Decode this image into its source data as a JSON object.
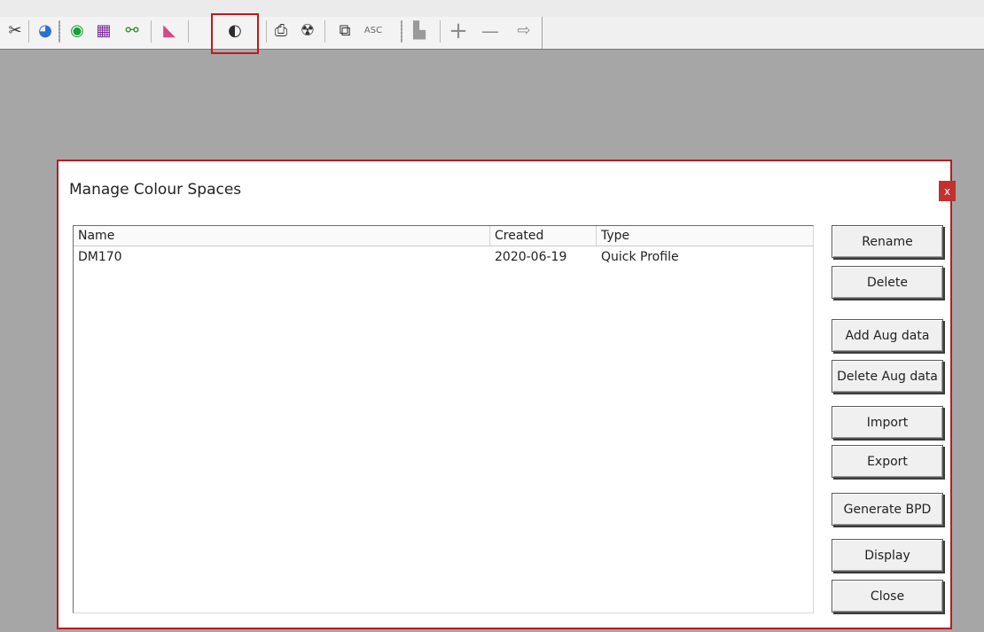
{
  "toolbar": {
    "icons": [
      {
        "name": "tools-icon",
        "glyph": "✂"
      },
      {
        "name": "globe-icon",
        "glyph": "◕"
      },
      {
        "name": "color-wheel-icon",
        "glyph": "◉"
      },
      {
        "name": "color-chart-icon",
        "glyph": "▦"
      },
      {
        "name": "network-icon",
        "glyph": "⚯"
      },
      {
        "name": "gamut-icon",
        "glyph": "◣"
      },
      {
        "name": "colour-spaces-icon",
        "glyph": "◐"
      },
      {
        "name": "print-icon",
        "glyph": "⎙"
      },
      {
        "name": "radiation-icon",
        "glyph": "☢"
      },
      {
        "name": "copy-icon",
        "glyph": "⧉"
      },
      {
        "name": "asc-icon",
        "glyph": "ASC"
      },
      {
        "name": "save-icon",
        "glyph": "▙"
      },
      {
        "name": "plus-icon",
        "glyph": "+"
      },
      {
        "name": "minus-icon",
        "glyph": "—"
      },
      {
        "name": "export-icon",
        "glyph": "⇨"
      }
    ]
  },
  "dialog": {
    "title": "Manage Colour Spaces",
    "close_glyph": "x",
    "columns": [
      "Name",
      "Created",
      "Type"
    ],
    "rows": [
      {
        "name": "DM170",
        "created": "2020-06-19",
        "type": "Quick Profile"
      }
    ],
    "buttons": {
      "rename": "Rename",
      "delete": "Delete",
      "add_aug": "Add Aug data",
      "delete_aug": "Delete Aug data",
      "import": "Import",
      "export": "Export",
      "generate_bpd": "Generate BPD",
      "display": "Display",
      "close": "Close"
    }
  },
  "colors": {
    "highlight": "#c0181e",
    "close_bg": "#c2302f",
    "workspace": "#a6a6a6"
  }
}
